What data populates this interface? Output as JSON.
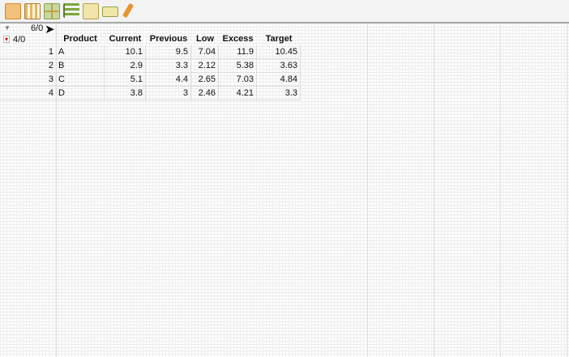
{
  "toolbar": {
    "icons": [
      "data-table-icon",
      "columns-icon",
      "grid-icon",
      "distribution-icon",
      "fit-xy-icon",
      "script-icon",
      "edit-pencil-icon"
    ]
  },
  "corner": {
    "columns_count": "6/0",
    "rows_count": "4/0"
  },
  "table": {
    "columns": [
      "Product",
      "Current",
      "Previous",
      "Low",
      "Excess",
      "Target"
    ],
    "rows": [
      {
        "n": "1",
        "cells": [
          "A",
          "10.1",
          "9.5",
          "7.04",
          "11.9",
          "10.45"
        ]
      },
      {
        "n": "2",
        "cells": [
          "B",
          "2.9",
          "3.3",
          "2.12",
          "5.38",
          "3.63"
        ]
      },
      {
        "n": "3",
        "cells": [
          "C",
          "5.1",
          "4.4",
          "2.65",
          "7.03",
          "4.84"
        ]
      },
      {
        "n": "4",
        "cells": [
          "D",
          "3.8",
          "3",
          "2.46",
          "4.21",
          "3.3"
        ]
      }
    ]
  },
  "colors": {
    "icon_orange": "#e8952e",
    "icon_green": "#7fa63a",
    "icon_yellow": "#e6d27a"
  }
}
